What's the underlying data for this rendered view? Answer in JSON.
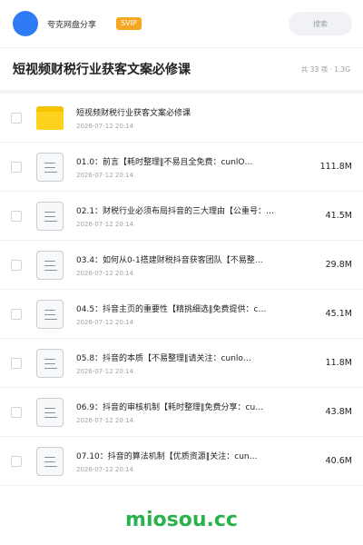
{
  "header": {
    "share_name": "夸克网盘分享",
    "badge": "SVIP",
    "search_placeholder": "搜索"
  },
  "folder": {
    "title": "短视频财税行业获客文案必修课",
    "meta": "共 33 项 · 1.3G"
  },
  "items": [
    {
      "type": "folder",
      "name": "短视频财税行业获客文案必修课",
      "date": "2026-07-12 20:14",
      "size": ""
    },
    {
      "type": "file",
      "name": "01.0：前言【耗时整理‖不易且全免费：cunlO…",
      "date": "2026-07-12 20:14",
      "size": "111.8M"
    },
    {
      "type": "file",
      "name": "02.1：财税行业必须布局抖音的三大理由【公重号：…",
      "date": "2026-07-12 20:14",
      "size": "41.5M"
    },
    {
      "type": "file",
      "name": "03.4：如何从0-1搭建财税抖音获客团队【不易整…",
      "date": "2026-07-12 20:14",
      "size": "29.8M"
    },
    {
      "type": "file",
      "name": "04.5：抖音主页的重要性【精挑细选‖免费提供：c…",
      "date": "2026-07-12 20:14",
      "size": "45.1M"
    },
    {
      "type": "file",
      "name": "05.8：抖音的本质【不易整理‖请关注：cunlo…",
      "date": "2026-07-12 20:14",
      "size": "11.8M"
    },
    {
      "type": "file",
      "name": "06.9：抖音的审核机制【耗时整理‖免费分享：cu…",
      "date": "2026-07-12 20:14",
      "size": "43.8M"
    },
    {
      "type": "file",
      "name": "07.10：抖音的算法机制【优质资源‖关注：cun…",
      "date": "2026-07-12 20:14",
      "size": "40.6M"
    }
  ],
  "watermark": "miosou.cc"
}
